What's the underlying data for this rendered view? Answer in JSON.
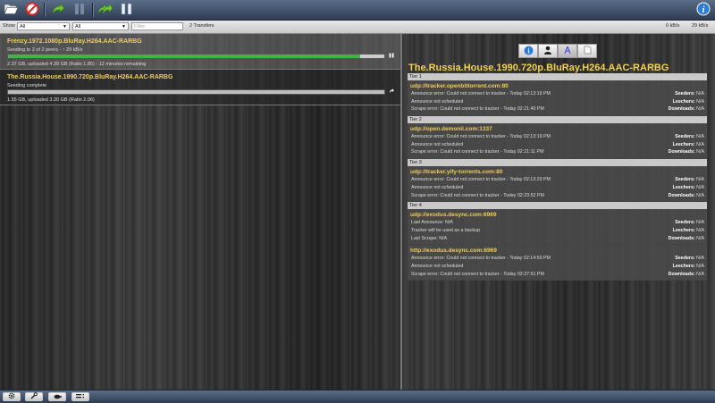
{
  "toolbar": {
    "buttons": [
      {
        "name": "open-torrent-button",
        "icon": "folder-open-icon"
      },
      {
        "name": "remove-torrent-button",
        "icon": "remove-circle-icon"
      },
      {
        "name": "resume-button",
        "icon": "resume-arrow-icon"
      },
      {
        "name": "pause-button",
        "icon": "pause-icon"
      },
      {
        "name": "resume-all-button",
        "icon": "resume-all-arrow-icon"
      },
      {
        "name": "pause-all-button",
        "icon": "pause-all-icon"
      },
      {
        "name": "inspector-toggle-button",
        "icon": "info-icon"
      }
    ]
  },
  "filterbar": {
    "show_label": "Show",
    "state_filter": "All",
    "tracker_filter": "All",
    "filter_placeholder": "Filter",
    "torrent_count": "2 Transfers",
    "down_speed": "0 kB/s",
    "up_speed": "29 kB/s"
  },
  "torrents": [
    {
      "name": "Frenzy.1972.1080p.BluRay.H264.AAC-RARBG",
      "peers": "Seeding to 2 of 2 peers - ↑ 29 kB/s",
      "progress": 0.935,
      "bar_color": "#3db54a",
      "stats": "2.37 GB, uploaded 4.39 GB (Ratio 1.85) - 12 minutes remaining",
      "button_icon": "pause-icon"
    },
    {
      "name": "The.Russia.House.1990.720p.BluRay.H264.AAC-RARBG",
      "peers": "Seeding complete",
      "progress": 1.0,
      "bar_color": "#bdbdbd",
      "stats": "1.55 GB, uploaded 3.20 GB (Ratio 2.06)",
      "button_icon": "resume-icon"
    }
  ],
  "inspector": {
    "tabs": [
      {
        "name": "info",
        "icon": "info-icon"
      },
      {
        "name": "peers",
        "icon": "person-icon"
      },
      {
        "name": "trackers",
        "icon": "tracker-icon"
      },
      {
        "name": "files",
        "icon": "file-icon"
      }
    ],
    "title": "The.Russia.House.1990.720p.BluRay.H264.AAC-RARBG",
    "tiers": [
      {
        "label": "Tier 1",
        "trackers": [
          {
            "url": "udp://tracker.openbittorrent.com:80",
            "lines": [
              {
                "left": "Announce error: Could not connect to tracker - Today 02:13:19 PM",
                "rk": "Seeders:",
                "rv": "N/A"
              },
              {
                "left": "Announce not scheduled",
                "rk": "Leechers:",
                "rv": "N/A"
              },
              {
                "left": "Scrape error: Could not connect to tracker - Today 02:21:40 PM",
                "rk": "Downloads:",
                "rv": "N/A"
              }
            ]
          }
        ]
      },
      {
        "label": "Tier 2",
        "trackers": [
          {
            "url": "udp://open.demonii.com:1337",
            "lines": [
              {
                "left": "Announce error: Could not connect to tracker - Today 02:13:19 PM",
                "rk": "Seeders:",
                "rv": "N/A"
              },
              {
                "left": "Announce not scheduled",
                "rk": "Leechers:",
                "rv": "N/A"
              },
              {
                "left": "Scrape error: Could not connect to tracker - Today 02:21:11 PM",
                "rk": "Downloads:",
                "rv": "N/A"
              }
            ]
          }
        ]
      },
      {
        "label": "Tier 3",
        "trackers": [
          {
            "url": "udp://tracker.yify-torrents.com:80",
            "lines": [
              {
                "left": "Announce error: Could not connect to tracker - Today 02:13:29 PM",
                "rk": "Seeders:",
                "rv": "N/A"
              },
              {
                "left": "Announce not scheduled",
                "rk": "Leechers:",
                "rv": "N/A"
              },
              {
                "left": "Scrape error: Could not connect to tracker - Today 02:23:52 PM",
                "rk": "Downloads:",
                "rv": "N/A"
              }
            ]
          }
        ]
      },
      {
        "label": "Tier 4",
        "trackers": [
          {
            "url": "udp://exodus.desync.com:6969",
            "lines": [
              {
                "left": "Last Announce: N/A",
                "rk": "Seeders:",
                "rv": "N/A"
              },
              {
                "left": "Tracker will be used as a backup",
                "rk": "Leechers:",
                "rv": "N/A"
              },
              {
                "left": "Last Scrape: N/A",
                "rk": "Downloads:",
                "rv": "N/A"
              }
            ]
          },
          {
            "url": "http://exodus.desync.com:6969",
            "lines": [
              {
                "left": "Announce error: Could not connect to tracker - Today 02:14:50 PM",
                "rk": "Seeders:",
                "rv": "N/A"
              },
              {
                "left": "Announce not scheduled",
                "rk": "Leechers:",
                "rv": "N/A"
              },
              {
                "left": "Scrape error: Could not connect to tracker - Today 03:37:51 PM",
                "rk": "Downloads:",
                "rv": "N/A"
              }
            ]
          }
        ]
      }
    ]
  },
  "bottombar": {
    "buttons": [
      {
        "name": "settings-button",
        "icon": "gear-icon"
      },
      {
        "name": "preferences-button",
        "icon": "wrench-icon"
      },
      {
        "name": "turtle-mode-button",
        "icon": "turtle-icon"
      },
      {
        "name": "compact-view-button",
        "icon": "list-icon"
      }
    ]
  },
  "colors": {
    "accent_yellow": "#f0d050",
    "toolbar_blue": "#3d4e66"
  }
}
